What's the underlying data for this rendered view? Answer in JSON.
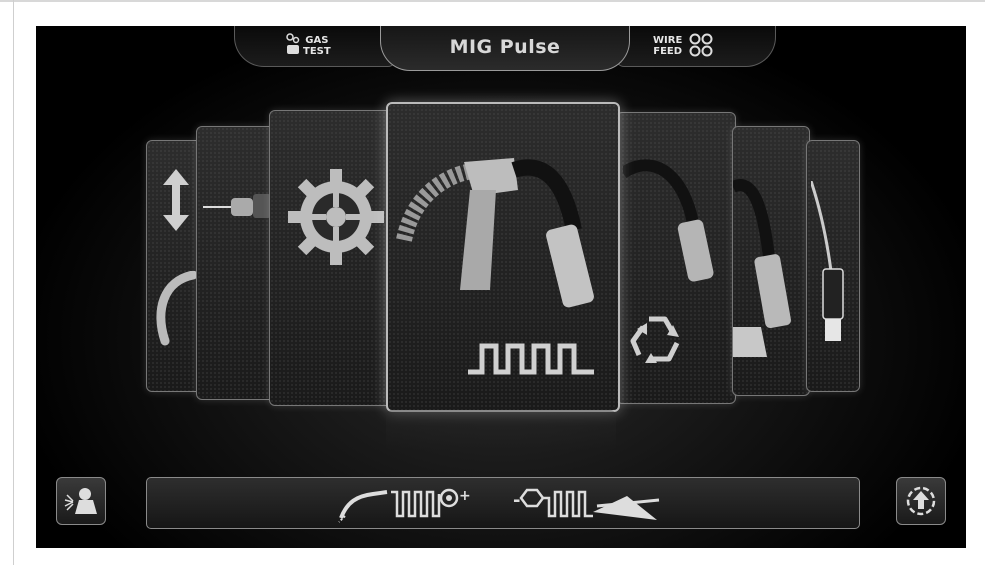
{
  "top_tabs": {
    "gas_test": {
      "line1": "GAS",
      "line2": "TEST"
    },
    "mode_title": "MIG Pulse",
    "wire_feed": {
      "line1": "WIRE",
      "line2": "FEED"
    }
  },
  "carousel": {
    "cards": [
      {
        "name": "card-trigger-mode",
        "icon": "up-down-arrow-icon"
      },
      {
        "name": "card-torch-tip",
        "icon": "torch-tip-icon"
      },
      {
        "name": "card-settings",
        "icon": "gear-icon"
      },
      {
        "name": "card-mig-pulse",
        "icon": "pulse-waveform-icon",
        "selected": true
      },
      {
        "name": "card-recycle",
        "icon": "recycle-icon"
      },
      {
        "name": "card-mig-gun",
        "icon": "mig-gun-icon"
      },
      {
        "name": "card-tig-torch",
        "icon": "tig-torch-icon"
      }
    ]
  },
  "bottom_bar": {
    "left_button_icon": "welder-icon",
    "polarity_diagram_icon": "polarity-connection-icon",
    "right_button_icon": "upload-circle-icon"
  },
  "colors": {
    "background": "#000000",
    "card_border": "#777777",
    "selected_border": "#bbbbbb",
    "text": "#d8d8d8"
  }
}
